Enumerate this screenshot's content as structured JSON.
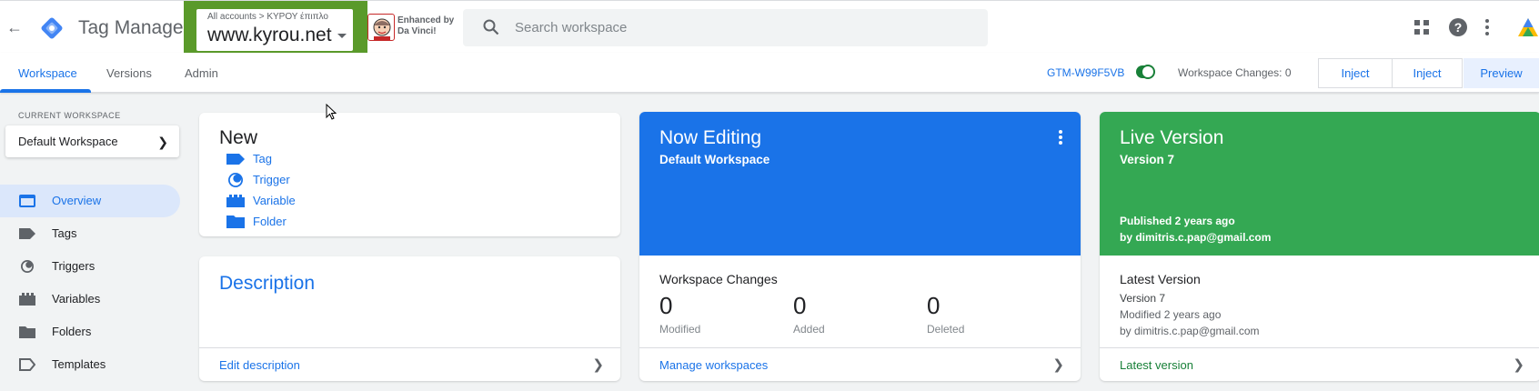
{
  "colors": {
    "accent": "#1a73e8",
    "highlight_box": "#5a9a2a",
    "now_editing_bg": "#1a73e8",
    "live_version_bg": "#34a853",
    "toggle_on": "#188038"
  },
  "header": {
    "back_icon": "arrow-back-icon",
    "app_title": "Tag Manager",
    "account_crumb": "All accounts > ΚΥΡΟΥ έπιπλο",
    "account_name": "www.kyrou.net",
    "extension_label_1": "Enhanced by",
    "extension_label_2": "Da Vinci!",
    "search_placeholder": "Search workspace",
    "icons": [
      "apps-grid-icon",
      "help-icon",
      "more-vert-icon",
      "analytics-logo-icon"
    ]
  },
  "nav": {
    "tabs": [
      {
        "label": "Workspace",
        "active": true
      },
      {
        "label": "Versions",
        "active": false
      },
      {
        "label": "Admin",
        "active": false
      }
    ],
    "container_id": "GTM-W99F5VB",
    "workspace_changes": "Workspace Changes: 0",
    "buttons": {
      "inject_1": "Inject",
      "inject_2": "Inject",
      "preview": "Preview"
    }
  },
  "sidebar": {
    "current_workspace_label": "CURRENT WORKSPACE",
    "workspace_name": "Default Workspace",
    "items": [
      {
        "label": "Overview",
        "icon": "overview-icon",
        "active": true
      },
      {
        "label": "Tags",
        "icon": "tag-icon",
        "active": false
      },
      {
        "label": "Triggers",
        "icon": "trigger-icon",
        "active": false
      },
      {
        "label": "Variables",
        "icon": "variable-icon",
        "active": false
      },
      {
        "label": "Folders",
        "icon": "folder-icon",
        "active": false
      },
      {
        "label": "Templates",
        "icon": "template-icon",
        "active": false
      }
    ]
  },
  "new_card": {
    "title": "New",
    "items": [
      {
        "label": "Tag",
        "icon": "tag-icon"
      },
      {
        "label": "Trigger",
        "icon": "trigger-icon"
      },
      {
        "label": "Variable",
        "icon": "variable-icon"
      },
      {
        "label": "Folder",
        "icon": "folder-icon"
      }
    ]
  },
  "description_card": {
    "title": "Description",
    "footer_link": "Edit description"
  },
  "now_editing_card": {
    "title": "Now Editing",
    "subtitle": "Default Workspace",
    "stats_title": "Workspace Changes",
    "stats": [
      {
        "value": "0",
        "label": "Modified"
      },
      {
        "value": "0",
        "label": "Added"
      },
      {
        "value": "0",
        "label": "Deleted"
      }
    ],
    "footer_link": "Manage workspaces"
  },
  "live_version_card": {
    "title": "Live Version",
    "subtitle": "Version 7",
    "published": "Published 2 years ago",
    "published_by": "by dimitris.c.pap@gmail.com",
    "latest_title": "Latest Version",
    "latest_version": "Version 7",
    "latest_modified": "Modified 2 years ago",
    "latest_by": "by dimitris.c.pap@gmail.com",
    "footer_link": "Latest version"
  }
}
